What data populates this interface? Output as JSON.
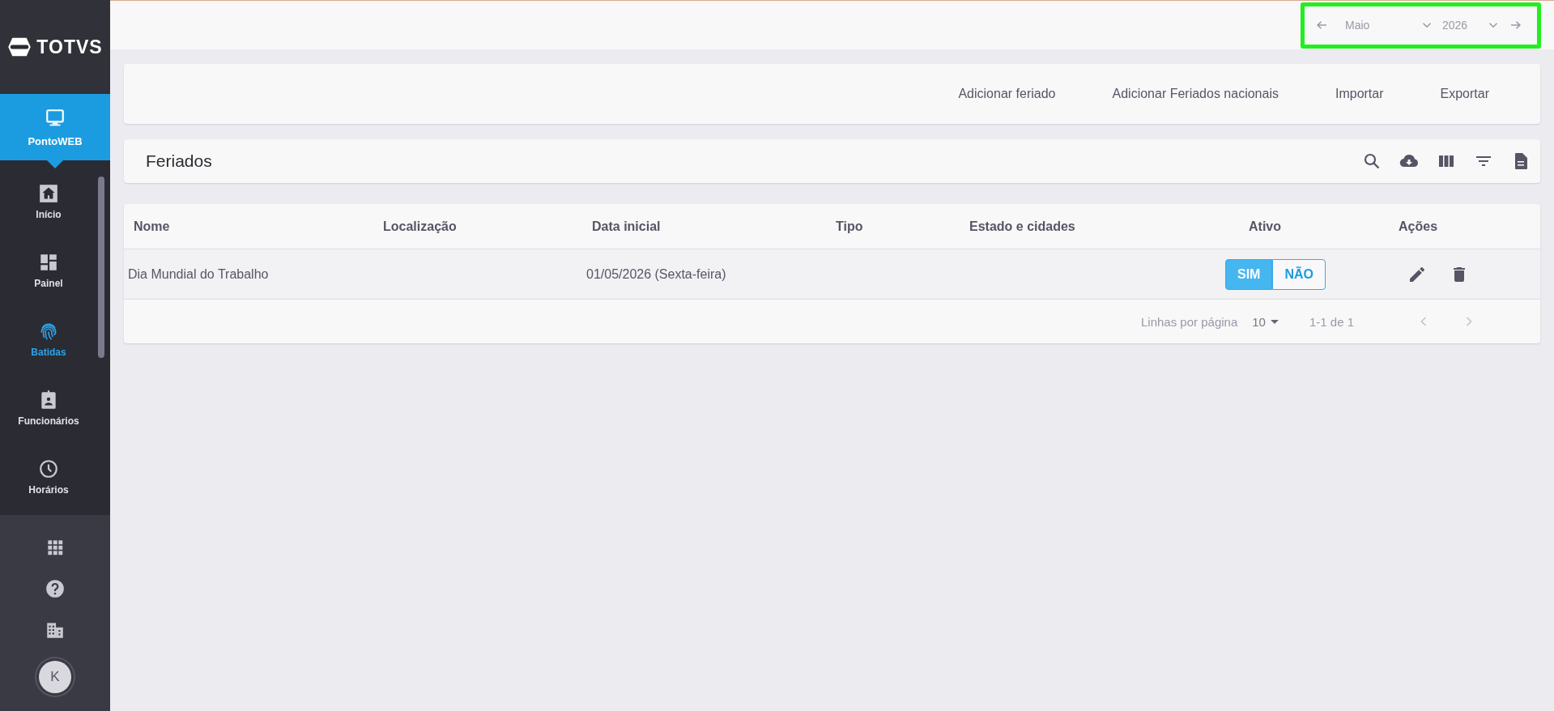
{
  "sidebar": {
    "logo": "TOTVS",
    "module": {
      "label": "PontoWEB",
      "selected": true
    },
    "items": [
      {
        "label": "Início",
        "selected": false
      },
      {
        "label": "Painel",
        "selected": false
      },
      {
        "label": "Batidas",
        "selected": true
      },
      {
        "label": "Funcionários",
        "selected": false
      },
      {
        "label": "Horários",
        "selected": false
      }
    ],
    "avatar": "K"
  },
  "period": {
    "month": "Maio",
    "year": "2026"
  },
  "actions": [
    "Adicionar feriado",
    "Adicionar Feriados nacionais",
    "Importar",
    "Exportar"
  ],
  "panel": {
    "title": "Feriados"
  },
  "table": {
    "columns": [
      "Nome",
      "Localização",
      "Data inicial",
      "Tipo",
      "Estado e cidades",
      "Ativo",
      "Ações"
    ],
    "rows": [
      {
        "name": "Dia Mundial do Trabalho",
        "start_date": "01/05/2026 (Sexta-feira)",
        "active": [
          {
            "label": "SIM",
            "selected": true
          },
          {
            "label": "NÃO",
            "selected": false
          }
        ]
      }
    ]
  },
  "pagination": {
    "rows_label": "Linhas por página",
    "rows_per_page": "10",
    "range": "1-1 de 1",
    "prev_disabled": true,
    "next_disabled": true
  }
}
